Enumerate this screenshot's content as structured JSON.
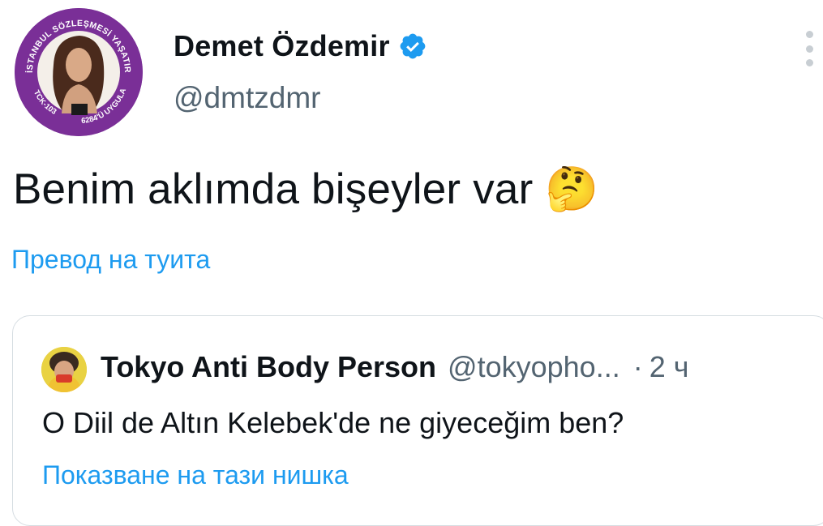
{
  "tweet": {
    "author": {
      "name": "Demet Özdemir",
      "handle": "@dmtzdmr",
      "verified": true,
      "avatar_ring_text_top": "İSTANBUL SÖZLEŞMESİ YAŞATIR",
      "avatar_ring_text_bottom_left": "TCK-103",
      "avatar_ring_text_bottom_right": "6284'Ü UYGULA"
    },
    "text": "Benim aklımda bişeyler var 🤔",
    "translate_label": "Превод на туита",
    "menu_icon": "more-vertical-icon"
  },
  "quoted": {
    "name": "Tokyo Anti Body Person",
    "handle": "@tokyopho...",
    "separator": "·",
    "time": "2 ч",
    "text": "O Diil de Altın Kelebek'de ne giyeceğim ben?",
    "thread_label": "Показване на тази нишка"
  },
  "colors": {
    "accent": "#1d9bf0",
    "secondary_text": "#536471",
    "avatar_ring": "#7a2f97",
    "border": "#d6dde2"
  }
}
